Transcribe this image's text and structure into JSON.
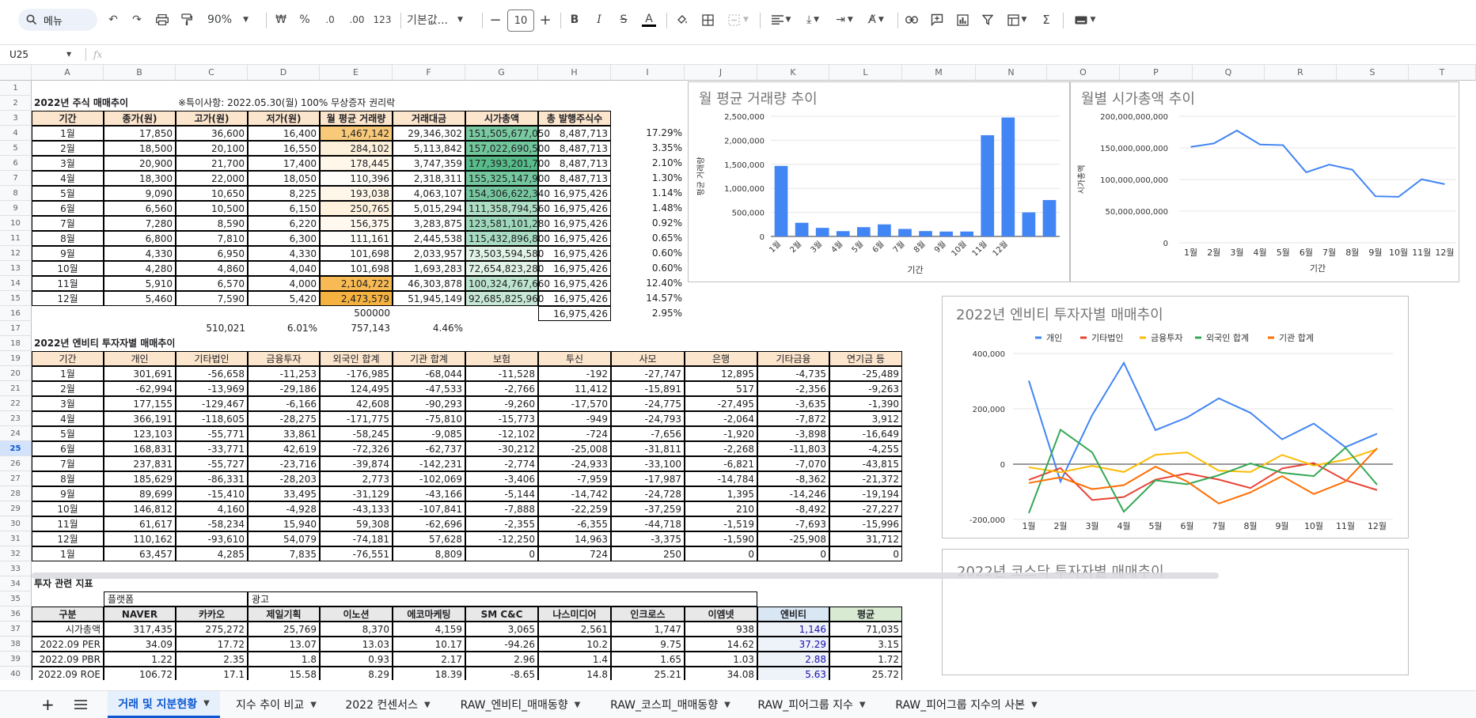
{
  "toolbar": {
    "search_label": "메뉴",
    "zoom": "90%",
    "currency": "₩",
    "percent": "%",
    "dec_less": ".0",
    "dec_more": ".00",
    "num_format": "123",
    "font": "기본값...",
    "font_size": "10"
  },
  "formula_bar": {
    "cell_ref": "U25",
    "fx": "fx"
  },
  "columns": [
    "A",
    "B",
    "C",
    "D",
    "E",
    "F",
    "G",
    "H",
    "I",
    "J",
    "K",
    "L",
    "M",
    "N",
    "O",
    "P",
    "Q",
    "R",
    "S",
    "T"
  ],
  "rows": [
    "1",
    "2",
    "3",
    "4",
    "5",
    "6",
    "7",
    "8",
    "9",
    "10",
    "11",
    "12",
    "13",
    "14",
    "15",
    "16",
    "17",
    "18",
    "19",
    "20",
    "21",
    "22",
    "23",
    "24",
    "25",
    "26",
    "27",
    "28",
    "29",
    "30",
    "31",
    "32",
    "33",
    "34",
    "35",
    "36",
    "37",
    "38",
    "39",
    "40"
  ],
  "active_row": "25",
  "section1": {
    "title": "2022년 주식 매매추이",
    "note": "※특이사항: 2022.05.30(월) 100% 무상증자 권리락",
    "headers": [
      "기간",
      "종가(원)",
      "고가(원)",
      "저가(원)",
      "월 평균 거래량",
      "거래대금",
      "시가총액",
      "총 발행주식수"
    ],
    "rows": [
      [
        "1월",
        "17,850",
        "36,600",
        "16,400",
        "1,467,142",
        "29,346,302",
        "151,505,677,050",
        "8,487,713",
        "17.29%"
      ],
      [
        "2월",
        "18,500",
        "20,100",
        "16,550",
        "284,102",
        "5,113,842",
        "157,022,690,500",
        "8,487,713",
        "3.35%"
      ],
      [
        "3월",
        "20,900",
        "21,700",
        "17,400",
        "178,445",
        "3,747,359",
        "177,393,201,700",
        "8,487,713",
        "2.10%"
      ],
      [
        "4월",
        "18,300",
        "22,000",
        "18,050",
        "110,396",
        "2,318,311",
        "155,325,147,900",
        "8,487,713",
        "1.30%"
      ],
      [
        "5월",
        "9,090",
        "10,650",
        "8,225",
        "193,038",
        "4,063,107",
        "154,306,622,340",
        "16,975,426",
        "1.14%"
      ],
      [
        "6월",
        "6,560",
        "10,500",
        "6,150",
        "250,765",
        "5,015,294",
        "111,358,794,560",
        "16,975,426",
        "1.48%"
      ],
      [
        "7월",
        "7,280",
        "8,590",
        "6,220",
        "156,375",
        "3,283,875",
        "123,581,101,280",
        "16,975,426",
        "0.92%"
      ],
      [
        "8월",
        "6,800",
        "7,810",
        "6,300",
        "111,161",
        "2,445,538",
        "115,432,896,800",
        "16,975,426",
        "0.65%"
      ],
      [
        "9월",
        "4,330",
        "6,950",
        "4,330",
        "101,698",
        "2,033,957",
        "73,503,594,580",
        "16,975,426",
        "0.60%"
      ],
      [
        "10월",
        "4,280",
        "4,860",
        "4,040",
        "101,698",
        "1,693,283",
        "72,654,823,280",
        "16,975,426",
        "0.60%"
      ],
      [
        "11월",
        "5,910",
        "6,570",
        "4,000",
        "2,104,722",
        "46,303,878",
        "100,324,767,660",
        "16,975,426",
        "12.40%"
      ],
      [
        "12월",
        "5,460",
        "7,590",
        "5,420",
        "2,473,579",
        "51,945,149",
        "92,685,825,960",
        "16,975,426",
        "14.57%"
      ]
    ],
    "row16": {
      "e": "500000",
      "h": "16,975,426",
      "i": "2.95%"
    },
    "row17": {
      "c": "510,021",
      "d": "6.01%",
      "e": "757,143",
      "f": "4.46%"
    }
  },
  "section2": {
    "title": "2022년 엔비티 투자자별 매매추이",
    "headers": [
      "기간",
      "개인",
      "기타법인",
      "금융투자",
      "외국인 합계",
      "기관 합계",
      "보험",
      "투신",
      "사모",
      "은행",
      "기타금융",
      "연기금 등"
    ],
    "rows": [
      [
        "1월",
        "301,691",
        "-56,658",
        "-11,253",
        "-176,985",
        "-68,044",
        "-11,528",
        "-192",
        "-27,747",
        "12,895",
        "-4,735",
        "-25,489"
      ],
      [
        "2월",
        "-62,994",
        "-13,969",
        "-29,186",
        "124,495",
        "-47,533",
        "-2,766",
        "11,412",
        "-15,891",
        "517",
        "-2,356",
        "-9,263"
      ],
      [
        "3월",
        "177,155",
        "-129,467",
        "-6,166",
        "42,608",
        "-90,293",
        "-9,260",
        "-17,570",
        "-24,775",
        "-27,495",
        "-3,635",
        "-1,390"
      ],
      [
        "4월",
        "366,191",
        "-118,605",
        "-28,275",
        "-171,775",
        "-75,810",
        "-15,773",
        "-949",
        "-24,793",
        "-2,064",
        "-7,872",
        "3,912"
      ],
      [
        "5월",
        "123,103",
        "-55,771",
        "33,861",
        "-58,245",
        "-9,085",
        "-12,102",
        "-724",
        "-7,656",
        "-1,920",
        "-3,898",
        "-16,649"
      ],
      [
        "6월",
        "168,831",
        "-33,771",
        "42,619",
        "-72,326",
        "-62,737",
        "-30,212",
        "-25,008",
        "-31,811",
        "-2,268",
        "-11,803",
        "-4,255"
      ],
      [
        "7월",
        "237,831",
        "-55,727",
        "-23,716",
        "-39,874",
        "-142,231",
        "-2,774",
        "-24,933",
        "-33,100",
        "-6,821",
        "-7,070",
        "-43,815"
      ],
      [
        "8월",
        "185,629",
        "-86,331",
        "-28,203",
        "2,773",
        "-102,069",
        "-3,406",
        "-7,959",
        "-17,987",
        "-14,784",
        "-8,362",
        "-21,372"
      ],
      [
        "9월",
        "89,699",
        "-15,410",
        "33,495",
        "-31,129",
        "-43,166",
        "-5,144",
        "-14,742",
        "-24,728",
        "1,395",
        "-14,246",
        "-19,194"
      ],
      [
        "10월",
        "146,812",
        "4,160",
        "-4,928",
        "-43,133",
        "-107,841",
        "-7,888",
        "-22,259",
        "-37,259",
        "210",
        "-8,492",
        "-27,227"
      ],
      [
        "11월",
        "61,617",
        "-58,234",
        "15,940",
        "59,308",
        "-62,696",
        "-2,355",
        "-6,355",
        "-44,718",
        "-1,519",
        "-7,693",
        "-15,996"
      ],
      [
        "12월",
        "110,162",
        "-93,610",
        "54,079",
        "-74,181",
        "57,628",
        "-12,250",
        "14,963",
        "-3,375",
        "-1,590",
        "-25,908",
        "31,712"
      ],
      [
        "1월",
        "63,457",
        "4,285",
        "7,835",
        "-76,551",
        "8,809",
        "0",
        "724",
        "250",
        "0",
        "0",
        "0"
      ]
    ]
  },
  "section3": {
    "title": "투자 관련 지표",
    "group1": "플랫폼",
    "group2": "광고",
    "headers": [
      "구분",
      "NAVER",
      "카카오",
      "제일기획",
      "이노션",
      "에코마케팅",
      "SM C&C",
      "나스미디어",
      "인크로스",
      "이엠넷",
      "엔비티",
      "평균"
    ],
    "rows": [
      [
        "시가총액",
        "317,435",
        "275,272",
        "25,769",
        "8,370",
        "4,159",
        "3,065",
        "2,561",
        "1,747",
        "938",
        "1,146",
        "71,035"
      ],
      [
        "2022.09 PER",
        "34.09",
        "17.72",
        "13.07",
        "13.03",
        "10.17",
        "-94.26",
        "10.2",
        "9.75",
        "14.62",
        "37.29",
        "3.15"
      ],
      [
        "2022.09 PBR",
        "1.22",
        "2.35",
        "1.8",
        "0.93",
        "2.17",
        "2.96",
        "1.4",
        "1.65",
        "1.03",
        "2.88",
        "1.72"
      ],
      [
        "2022.09 ROE",
        "106.72",
        "17.1",
        "15.58",
        "8.29",
        "18.39",
        "-8.65",
        "14.8",
        "25.21",
        "34.08",
        "5.63",
        "25.72"
      ]
    ]
  },
  "chart_data": [
    {
      "type": "bar",
      "title": "월 평균 거래량 추이",
      "xlabel": "기간",
      "ylabel": "평균 거래량",
      "categories": [
        "1월",
        "2월",
        "3월",
        "4월",
        "5월",
        "6월",
        "7월",
        "8월",
        "9월",
        "10월",
        "11월",
        "12월",
        ""
      ],
      "values": [
        1467142,
        284102,
        178445,
        110396,
        193038,
        250765,
        156375,
        111161,
        101698,
        101698,
        2104722,
        2473579,
        500000,
        757143
      ],
      "yticks": [
        "0",
        "500,000",
        "1,000,000",
        "1,500,000",
        "2,000,000",
        "2,500,000"
      ],
      "ylim": [
        0,
        2500000
      ],
      "color": "#4285f4"
    },
    {
      "type": "line",
      "title": "월별 시가총액 추이",
      "xlabel": "기간",
      "ylabel": "시가총액",
      "categories": [
        "1월",
        "2월",
        "3월",
        "4월",
        "5월",
        "6월",
        "7월",
        "8월",
        "9월",
        "10월",
        "11월",
        "12월"
      ],
      "values": [
        151505677050,
        157022690500,
        177393201700,
        155325147900,
        154306622340,
        111358794560,
        123581101280,
        115432896800,
        73503594580,
        72654823280,
        100324767660,
        92685825960
      ],
      "yticks": [
        "0",
        "50,000,000,000",
        "100,000,000,000",
        "150,000,000,000",
        "200,000,000,000"
      ],
      "ylim": [
        0,
        200000000000
      ],
      "color": "#4285f4"
    },
    {
      "type": "line",
      "title": "2022년 엔비티 투자자별 매매추이",
      "categories": [
        "1월",
        "2월",
        "3월",
        "4월",
        "5월",
        "6월",
        "7월",
        "8월",
        "9월",
        "10월",
        "11월",
        "12월"
      ],
      "yticks": [
        "-200,000",
        "0",
        "200,000",
        "400,000"
      ],
      "ylim": [
        -200000,
        400000
      ],
      "series": [
        {
          "name": "개인",
          "color": "#4285f4",
          "values": [
            301691,
            -62994,
            177155,
            366191,
            123103,
            168831,
            237831,
            185629,
            89699,
            146812,
            61617,
            110162
          ]
        },
        {
          "name": "기타법인",
          "color": "#ea4335",
          "values": [
            -56658,
            -13969,
            -129467,
            -118605,
            -55771,
            -33771,
            -55727,
            -86331,
            -15410,
            4160,
            -58234,
            -93610
          ]
        },
        {
          "name": "금융투자",
          "color": "#fbbc04",
          "values": [
            -11253,
            -29186,
            -6166,
            -28275,
            33861,
            42619,
            -23716,
            -28203,
            33495,
            -4928,
            15940,
            54079
          ]
        },
        {
          "name": "외국인 합계",
          "color": "#34a853",
          "values": [
            -176985,
            124495,
            42608,
            -171775,
            -58245,
            -72326,
            -39874,
            2773,
            -31129,
            -43133,
            59308,
            -74181
          ]
        },
        {
          "name": "기관 합계",
          "color": "#ff6d01",
          "values": [
            -68044,
            -47533,
            -90293,
            -75810,
            -9085,
            -62737,
            -142231,
            -102069,
            -43166,
            -107841,
            -62696,
            57628
          ]
        }
      ]
    }
  ],
  "chart4_title_partial": "2022년 코스닥 투자자별 매매추이",
  "tabs": [
    "거래 및 지분현황",
    "지수 추이 비교",
    "2022 컨센서스",
    "RAW_엔비티_매매동향",
    "RAW_코스피_매매동향",
    "RAW_피어그룹 지수",
    "RAW_피어그룹 지수의 사본"
  ]
}
